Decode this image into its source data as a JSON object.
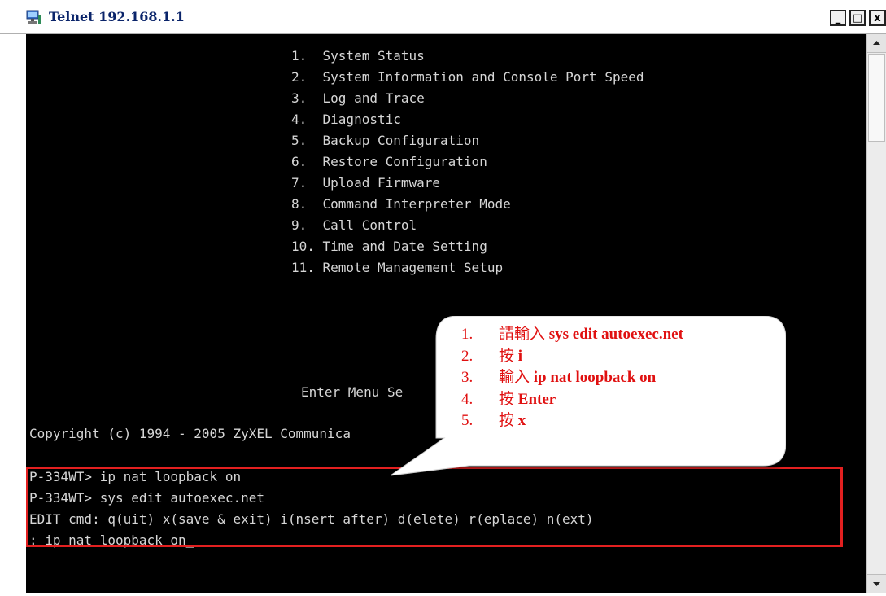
{
  "window": {
    "title": "Telnet 192.168.1.1",
    "minimize_label": "_",
    "restore_label": "□",
    "close_label": "x"
  },
  "terminal": {
    "menu": [
      "1.  System Status",
      "2.  System Information and Console Port Speed",
      "3.  Log and Trace",
      "4.  Diagnostic",
      "5.  Backup Configuration",
      "6.  Restore Configuration",
      "7.  Upload Firmware",
      "8.  Command Interpreter Mode",
      "9.  Call Control",
      "10. Time and Date Setting",
      "11. Remote Management Setup"
    ],
    "prompt": "Enter Menu Se",
    "copyright": "Copyright (c) 1994 - 2005 ZyXEL Communica",
    "command_lines": [
      "P-334WT> ip nat loopback on",
      "P-334WT> sys edit autoexec.net",
      "EDIT cmd: q(uit) x(save & exit) i(nsert after) d(elete) r(eplace) n(ext)",
      ": ip nat loopback on_"
    ]
  },
  "callout": {
    "steps": [
      {
        "num": "1.",
        "text": "請輸入",
        "keyword": "sys edit autoexec.net"
      },
      {
        "num": "2.",
        "text": "按",
        "keyword": "i"
      },
      {
        "num": "3.",
        "text": "輸入",
        "keyword": "ip nat loopback on"
      },
      {
        "num": "4.",
        "text": "按",
        "keyword": "Enter"
      },
      {
        "num": "5.",
        "text": "按",
        "keyword": "x"
      }
    ]
  },
  "colors": {
    "terminal_bg": "#000000",
    "terminal_text": "#d6d6d6",
    "title_text": "#0a246a",
    "annotation_red": "#e01010",
    "highlight_border": "#e32020"
  },
  "icons": [
    "telnet-app-icon",
    "minimize-icon",
    "restore-icon",
    "close-icon",
    "scroll-up-icon",
    "scroll-down-icon"
  ]
}
